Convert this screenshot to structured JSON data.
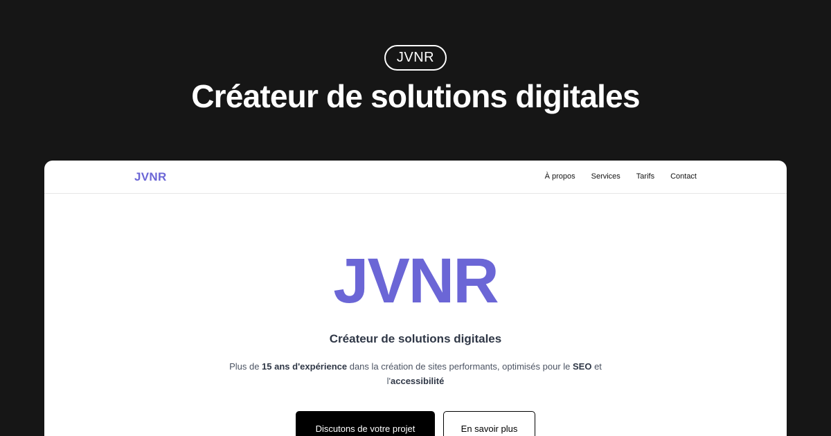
{
  "header": {
    "badge": "JVNR",
    "headline": "Créateur de solutions digitales"
  },
  "site": {
    "nav": {
      "logo": "JVNR",
      "links": [
        "À propos",
        "Services",
        "Tarifs",
        "Contact"
      ]
    },
    "hero": {
      "logo": "JVNR",
      "subtitle": "Créateur de solutions digitales",
      "desc_1": "Plus de ",
      "desc_bold_1": "15 ans d'expérience",
      "desc_2": " dans la création de sites performants, optimisés pour le ",
      "desc_bold_2": "SEO",
      "desc_3": " et l'",
      "desc_bold_3": "accessibilité",
      "primary_button": "Discutons de votre projet",
      "secondary_button": "En savoir plus"
    }
  },
  "colors": {
    "background": "#161616",
    "brand": "#6b66d6",
    "card": "#ffffff"
  }
}
